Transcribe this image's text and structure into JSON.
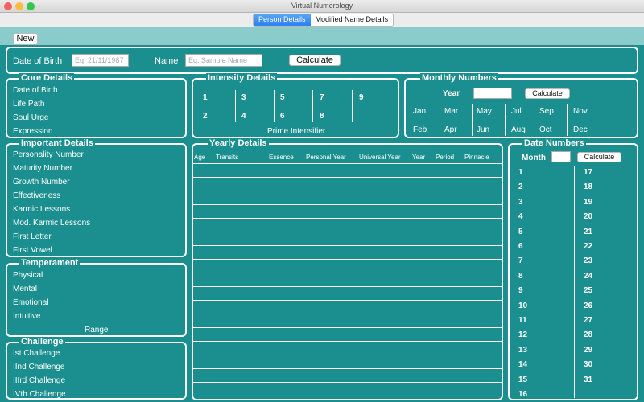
{
  "window": {
    "title": "Virtual Numerology"
  },
  "tabs": [
    "Person Details",
    "Modified Name Details"
  ],
  "toolbar": {
    "new_label": "New"
  },
  "inputs": {
    "dob_label": "Date of Birth",
    "dob_placeholder": "Eg. 21/11/1987",
    "name_label": "Name",
    "name_placeholder": "Eg. Sample Name",
    "calculate_label": "Calculate"
  },
  "core": {
    "title": "Core Details",
    "items": [
      "Date of Birth",
      "Life Path",
      "Soul Urge",
      "Expression"
    ]
  },
  "intensity": {
    "title": "Intensity Details",
    "row1": [
      "1",
      "3",
      "5",
      "7",
      "9"
    ],
    "row2": [
      "2",
      "4",
      "6",
      "8"
    ],
    "prime_label": "Prime Intensifier"
  },
  "monthly": {
    "title": "Monthly Numbers",
    "year_label": "Year",
    "calculate_label": "Calculate",
    "top": [
      "Jan",
      "Mar",
      "May",
      "Jul",
      "Sep",
      "Nov"
    ],
    "bottom": [
      "Feb",
      "Apr",
      "Jun",
      "Aug",
      "Oct",
      "Dec"
    ]
  },
  "important": {
    "title": "Important Details",
    "items": [
      "Personality Number",
      "Maturity Number",
      "Growth Number",
      "Effectiveness",
      "Karmic Lessons",
      "Mod. Karmic Lessons",
      "First Letter",
      "First Vowel"
    ]
  },
  "temperament": {
    "title": "Temperament",
    "items": [
      "Physical",
      "Mental",
      "Emotional",
      "Intuitive"
    ],
    "range_label": "Range"
  },
  "challenge": {
    "title": "Challenge",
    "items": [
      "Ist Challenge",
      "IInd Challenge",
      "IIIrd Challenge",
      "IVth Challenge"
    ]
  },
  "yearly": {
    "title": "Yearly Details",
    "columns": [
      "Age",
      "Transits",
      "Essence",
      "Personal Year",
      "Universal Year",
      "Year",
      "Period",
      "Pinnacle"
    ]
  },
  "dates": {
    "title": "Date Numbers",
    "month_label": "Month",
    "calculate_label": "Calculate",
    "left": [
      "1",
      "2",
      "3",
      "4",
      "5",
      "6",
      "7",
      "8",
      "9",
      "10",
      "11",
      "12",
      "13",
      "14",
      "15",
      "16"
    ],
    "right": [
      "17",
      "18",
      "19",
      "20",
      "21",
      "22",
      "23",
      "24",
      "25",
      "26",
      "27",
      "28",
      "29",
      "30",
      "31"
    ]
  },
  "colors": {
    "background": "#1b8f8f",
    "strip": "#8acccb",
    "accent": "#2b7ff0"
  }
}
